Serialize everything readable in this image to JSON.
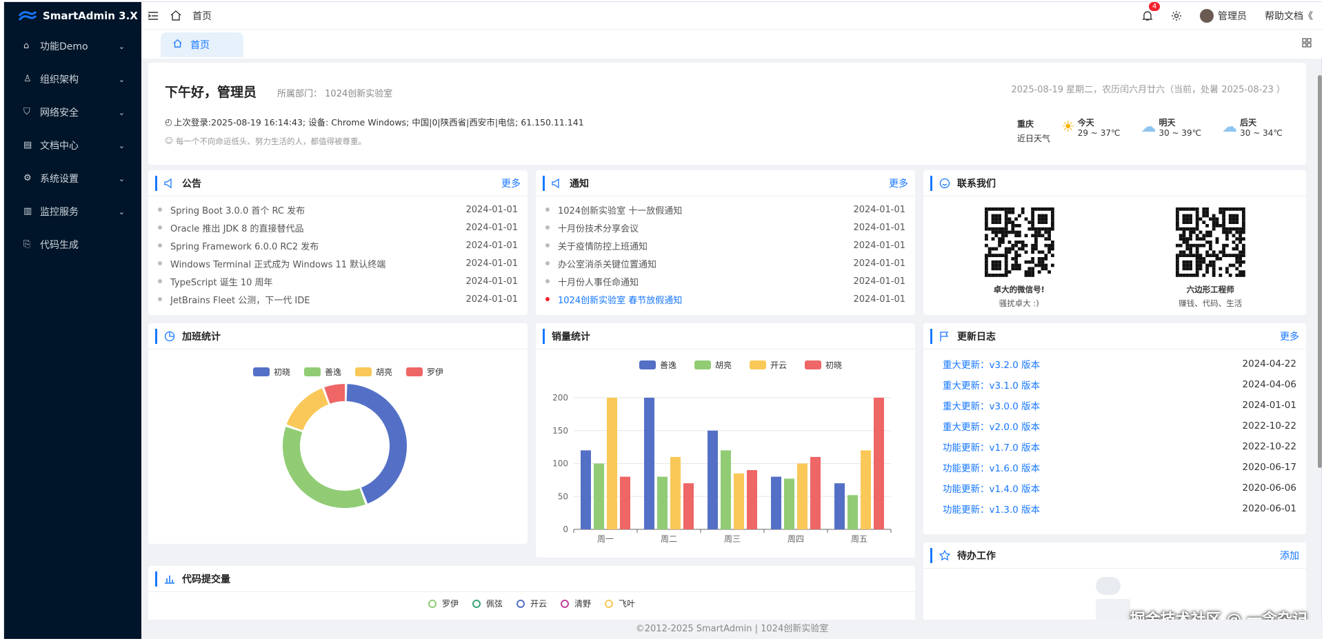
{
  "sidebar": {
    "logo": "SmartAdmin 3.X",
    "items": [
      {
        "label": "功能Demo",
        "icon": "bank-icon",
        "expandable": true
      },
      {
        "label": "组织架构",
        "icon": "user-icon",
        "expandable": true
      },
      {
        "label": "网络安全",
        "icon": "shield-icon",
        "expandable": true
      },
      {
        "label": "文档中心",
        "icon": "document-icon",
        "expandable": true
      },
      {
        "label": "系统设置",
        "icon": "gear-icon",
        "expandable": true
      },
      {
        "label": "监控服务",
        "icon": "chart-icon",
        "expandable": true
      },
      {
        "label": "代码生成",
        "icon": "code-icon",
        "expandable": false
      }
    ]
  },
  "topbar": {
    "breadcrumb": "首页",
    "notifications": "4",
    "user": "管理员",
    "help": "帮助文档"
  },
  "tabs": {
    "active": "首页"
  },
  "welcome": {
    "greeting": "下午好，管理员",
    "dept": "所属部门： 1024创新实验室",
    "last_login": "上次登录:2025-08-19 16:14:43; 设备: Chrome Windows; 中国|0|陕西省|西安市|电信; 61.150.11.141",
    "quote": "每一个不向命运低头、努力生活的人，都值得被尊重。",
    "date": "2025-08-19 星期二，农历闰六月廿六（当前，处暑 2025-08-23 ）",
    "city": "重庆",
    "weather_label": "近日天气",
    "forecast": [
      {
        "day": "今天",
        "range": "29 ~ 37℃",
        "icon": "sunny-icon"
      },
      {
        "day": "明天",
        "range": "30 ~ 39℃",
        "icon": "rain-icon"
      },
      {
        "day": "后天",
        "range": "30 ~ 34℃",
        "icon": "rain-icon"
      }
    ]
  },
  "notice": {
    "title": "公告",
    "more": "更多",
    "items": [
      {
        "title": "Spring Boot 3.0.0 首个 RC 发布",
        "date": "2024-01-01"
      },
      {
        "title": "Oracle 推出 JDK 8 的直接替代品",
        "date": "2024-01-01"
      },
      {
        "title": "Spring Framework 6.0.0 RC2 发布",
        "date": "2024-01-01"
      },
      {
        "title": "Windows Terminal 正式成为 Windows 11 默认终端",
        "date": "2024-01-01"
      },
      {
        "title": "TypeScript 诞生 10 周年",
        "date": "2024-01-01"
      },
      {
        "title": "JetBrains Fleet 公测，下一代 IDE",
        "date": "2024-01-01"
      }
    ]
  },
  "inform": {
    "title": "通知",
    "more": "更多",
    "items": [
      {
        "title": "1024创新实验室 十一放假通知",
        "date": "2024-01-01",
        "highlight": false
      },
      {
        "title": "十月份技术分享会议",
        "date": "2024-01-01",
        "highlight": false
      },
      {
        "title": "关于疫情防控上班通知",
        "date": "2024-01-01",
        "highlight": false
      },
      {
        "title": "办公室消杀关键位置通知",
        "date": "2024-01-01",
        "highlight": false
      },
      {
        "title": "十月份人事任命通知",
        "date": "2024-01-01",
        "highlight": false
      },
      {
        "title": "1024创新实验室 春节放假通知",
        "date": "2024-01-01",
        "highlight": true
      }
    ]
  },
  "contact": {
    "title": "联系我们",
    "qr": [
      {
        "name": "卓大的微信号!",
        "desc": "骚扰卓大 :)"
      },
      {
        "name": "六边形工程师",
        "desc": "赚钱、代码、生活"
      }
    ]
  },
  "overtime": {
    "title": "加班统计"
  },
  "sales": {
    "title": "销量统计"
  },
  "changelog": {
    "title": "更新日志",
    "more": "更多",
    "items": [
      {
        "name": "重大更新：v3.2.0 版本",
        "date": "2024-04-22"
      },
      {
        "name": "重大更新：v3.1.0 版本",
        "date": "2024-04-06"
      },
      {
        "name": "重大更新：v3.0.0 版本",
        "date": "2024-01-01"
      },
      {
        "name": "重大更新：v2.0.0 版本",
        "date": "2022-10-22"
      },
      {
        "name": "功能更新：v1.7.0 版本",
        "date": "2022-10-22"
      },
      {
        "name": "功能更新：v1.6.0 版本",
        "date": "2020-06-17"
      },
      {
        "name": "功能更新：v1.4.0 版本",
        "date": "2020-06-06"
      },
      {
        "name": "功能更新：v1.3.0 版本",
        "date": "2020-06-01"
      }
    ]
  },
  "todo": {
    "title": "待办工作",
    "add": "添加"
  },
  "commits": {
    "title": "代码提交量",
    "legend": [
      "罗伊",
      "佩弦",
      "开云",
      "清野",
      "飞叶"
    ],
    "colors": [
      "#91cc75",
      "#3ba272",
      "#5470c6",
      "#c23f9a",
      "#fac858"
    ]
  },
  "watermark_text": "掘金技术社区 @ 一念杂记",
  "footer": "©2012-2025 SmartAdmin | 1024创新实验室",
  "chart_data": [
    {
      "type": "pie",
      "title": "加班统计",
      "legend": [
        "初晓",
        "善逸",
        "胡亮",
        "罗伊"
      ],
      "values": [
        44,
        36,
        14,
        6
      ],
      "colors": [
        "#5470c6",
        "#91cc75",
        "#fac858",
        "#ee6666"
      ],
      "donut": true,
      "legend_position": "top"
    },
    {
      "type": "bar",
      "title": "销量统计",
      "categories": [
        "周一",
        "周二",
        "周三",
        "周四",
        "周五"
      ],
      "series": [
        {
          "name": "善逸",
          "values": [
            120,
            200,
            150,
            80,
            70
          ],
          "color": "#5470c6"
        },
        {
          "name": "胡亮",
          "values": [
            100,
            80,
            120,
            77,
            52
          ],
          "color": "#91cc75"
        },
        {
          "name": "开云",
          "values": [
            200,
            110,
            85,
            100,
            120
          ],
          "color": "#fac858"
        },
        {
          "name": "初晓",
          "values": [
            80,
            70,
            90,
            110,
            200
          ],
          "color": "#ee6666"
        }
      ],
      "ylim": [
        0,
        200
      ],
      "yticks": [
        0,
        50,
        100,
        150,
        200
      ],
      "grid": true,
      "legend_position": "top"
    }
  ]
}
